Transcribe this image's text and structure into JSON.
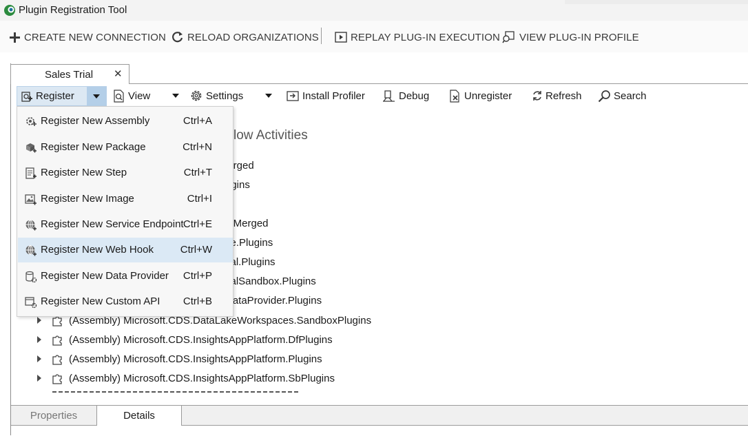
{
  "window": {
    "title": "Plugin Registration Tool"
  },
  "main_toolbar": {
    "create_connection": "CREATE NEW CONNECTION",
    "reload_orgs": "RELOAD ORGANIZATIONS",
    "replay_execution": "REPLAY PLUG-IN EXECUTION",
    "view_profile": "VIEW PLUG-IN PROFILE"
  },
  "tab": {
    "label": "Sales Trial",
    "close": "✕"
  },
  "org_toolbar": {
    "register": "Register",
    "view": "View",
    "settings": "Settings",
    "install_profiler": "Install Profiler",
    "debug": "Debug",
    "unregister": "Unregister",
    "refresh": "Refresh",
    "search": "Search"
  },
  "register_menu": {
    "items": [
      {
        "label": "Register New Assembly",
        "shortcut": "Ctrl+A",
        "icon": "assembly-icon"
      },
      {
        "label": "Register New Package",
        "shortcut": "Ctrl+N",
        "icon": "package-icon"
      },
      {
        "label": "Register New Step",
        "shortcut": "Ctrl+T",
        "icon": "step-icon"
      },
      {
        "label": "Register New Image",
        "shortcut": "Ctrl+I",
        "icon": "image-icon"
      },
      {
        "label": "Register New Service Endpoint",
        "shortcut": "Ctrl+E",
        "icon": "service-endpoint-icon"
      },
      {
        "label": "Register New Web Hook",
        "shortcut": "Ctrl+W",
        "icon": "web-hook-icon"
      },
      {
        "label": "Register New Data Provider",
        "shortcut": "Ctrl+P",
        "icon": "data-provider-icon"
      },
      {
        "label": "Register New Custom API",
        "shortcut": "Ctrl+B",
        "icon": "custom-api-icon"
      }
    ],
    "highlighted_index": 5
  },
  "tree": {
    "heading_fragment": "low Activities",
    "hidden_fragments": [
      "lerged",
      "ugins",
      "s.Merged",
      "ce.Plugins",
      "val.Plugins",
      "valSandbox.Plugins",
      "DataProvider.Plugins"
    ],
    "visible_rows": [
      "(Assembly) Microsoft.CDS.DataLakeWorkspaces.SandboxPlugins",
      "(Assembly) Microsoft.CDS.InsightsAppPlatform.DfPlugins",
      "(Assembly) Microsoft.CDS.InsightsAppPlatform.Plugins",
      "(Assembly) Microsoft.CDS.InsightsAppPlatform.SbPlugins"
    ]
  },
  "bottom_tabs": {
    "properties": "Properties",
    "details": "Details"
  },
  "colors": {
    "accent_blue": "#1b6ec2",
    "menu_highlight": "#dbe9f5",
    "register_button": "#dce8f3"
  }
}
